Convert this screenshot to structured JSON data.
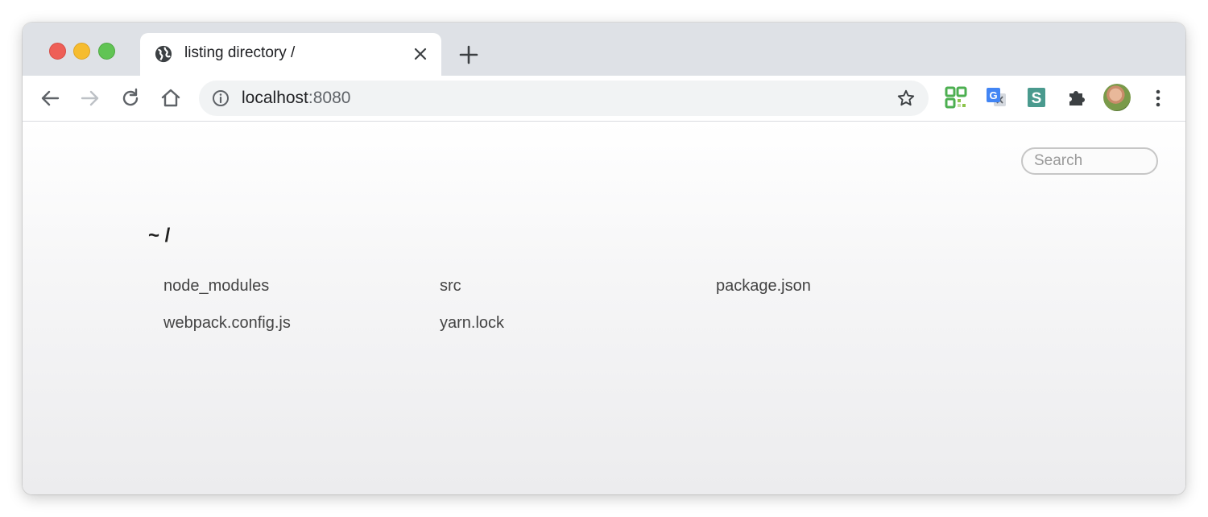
{
  "browser": {
    "tab": {
      "title": "listing directory /",
      "icon": "globe-icon"
    },
    "address_bar": {
      "host": "localhost",
      "port": ":8080"
    },
    "extensions": [
      "qr-code-extension-icon",
      "google-translate-icon",
      "s-extension-icon",
      "puzzle-extensions-icon"
    ],
    "colors": {
      "tabstrip": "#dee1e6",
      "close": "#ee5f57",
      "minimize": "#f6bc2f",
      "maximize": "#61c454"
    }
  },
  "page": {
    "search_placeholder": "Search",
    "heading": "~ /",
    "files": [
      "node_modules",
      "src",
      "package.json",
      "webpack.config.js",
      "yarn.lock"
    ]
  }
}
